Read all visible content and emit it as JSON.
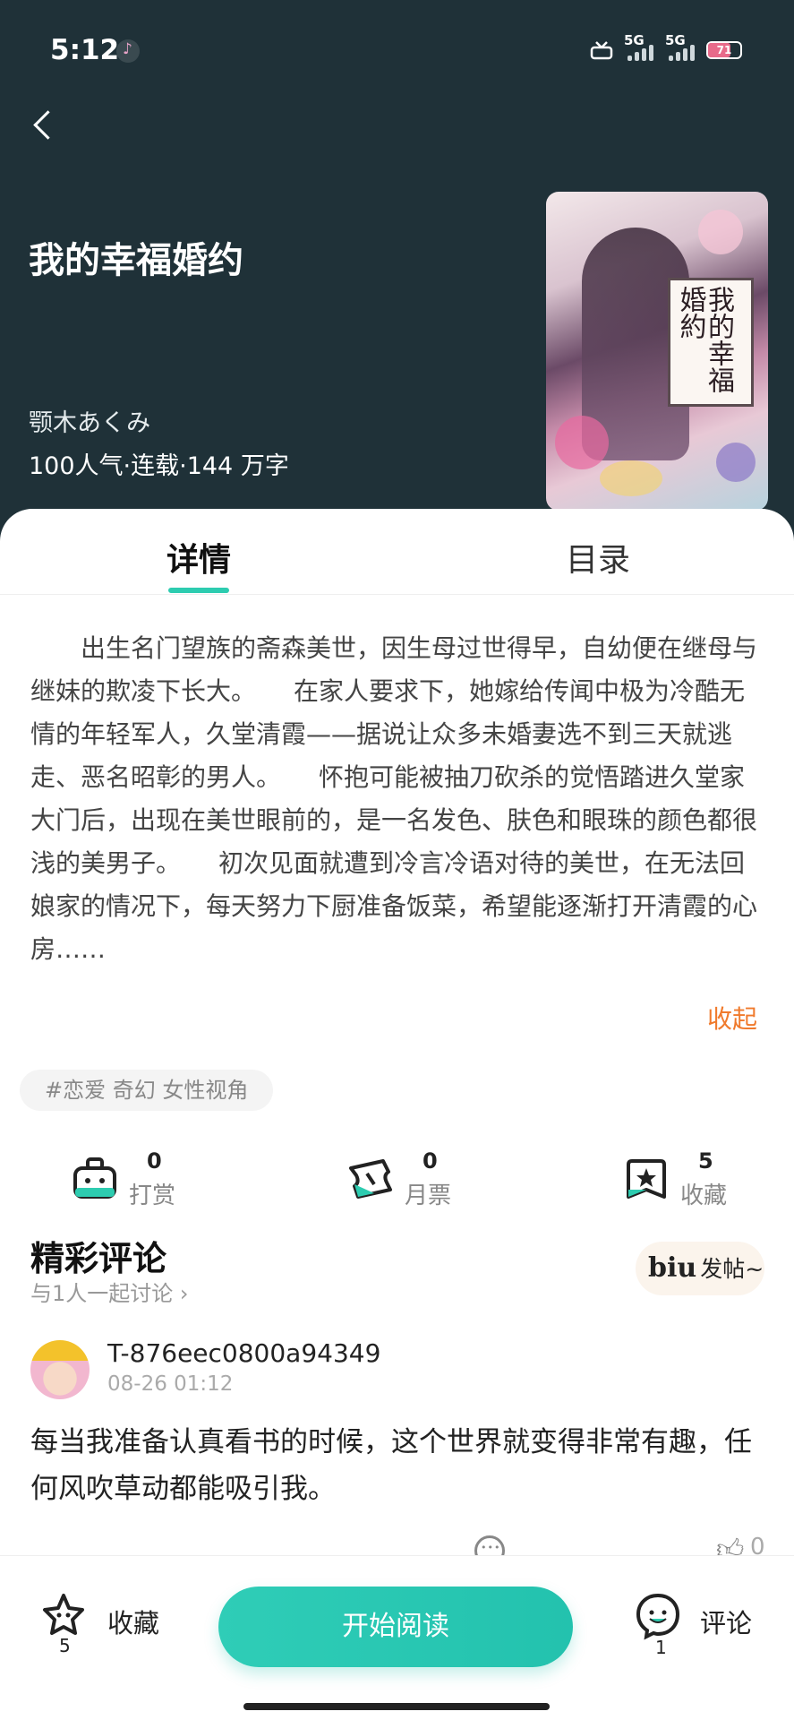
{
  "status_bar": {
    "time": "5:12",
    "network_1": "5G",
    "network_2": "5G",
    "battery": "71"
  },
  "book": {
    "title": "我的幸福婚约",
    "author": "颚木あくみ",
    "meta": "100人气·连载·144 万字",
    "cover_text": "我的幸福婚約"
  },
  "tabs": {
    "detail": "详情",
    "toc": "目录"
  },
  "synopsis": {
    "text": "　　出生名门望族的斋森美世，因生母过世得早，自幼便在继母与继妹的欺凌下长大。　　在家人要求下，她嫁给传闻中极为冷酷无情的年轻军人，久堂清霞——据说让众多未婚妻选不到三天就逃走、恶名昭彰的男人。　　怀抱可能被抽刀砍杀的觉悟踏进久堂家大门后，出现在美世眼前的，是一名发色、肤色和眼珠的颜色都很浅的美男子。　　初次见面就遭到冷言冷语对待的美世，在无法回娘家的情况下，每天努力下厨准备饭菜，希望能逐渐打开清霞的心房……",
    "collapse_label": "收起"
  },
  "tags": "#恋爱 奇幻 女性视角",
  "stats": [
    {
      "icon": "gift-box-icon",
      "count": "0",
      "label": "打赏"
    },
    {
      "icon": "ticket-icon",
      "count": "0",
      "label": "月票"
    },
    {
      "icon": "star-bookmark-icon",
      "count": "5",
      "label": "收藏"
    }
  ],
  "comments": {
    "title": "精彩评论",
    "subtitle": "与1人一起讨论",
    "post_logo": "biu",
    "post_label": "发帖~",
    "items": [
      {
        "user": "T-876eec0800a94349",
        "time": "08-26 01:12",
        "text": "每当我准备认真看书的时候，这个世界就变得非常有趣，任何风吹草动都能吸引我。",
        "likes": "0"
      }
    ]
  },
  "bottom_bar": {
    "favorite_label": "收藏",
    "favorite_count": "5",
    "read_label": "开始阅读",
    "comment_label": "评论",
    "comment_count": "1"
  },
  "colors": {
    "header_bg": "#1f3138",
    "accent": "#2dccb0",
    "collapse": "#f07a2c"
  }
}
